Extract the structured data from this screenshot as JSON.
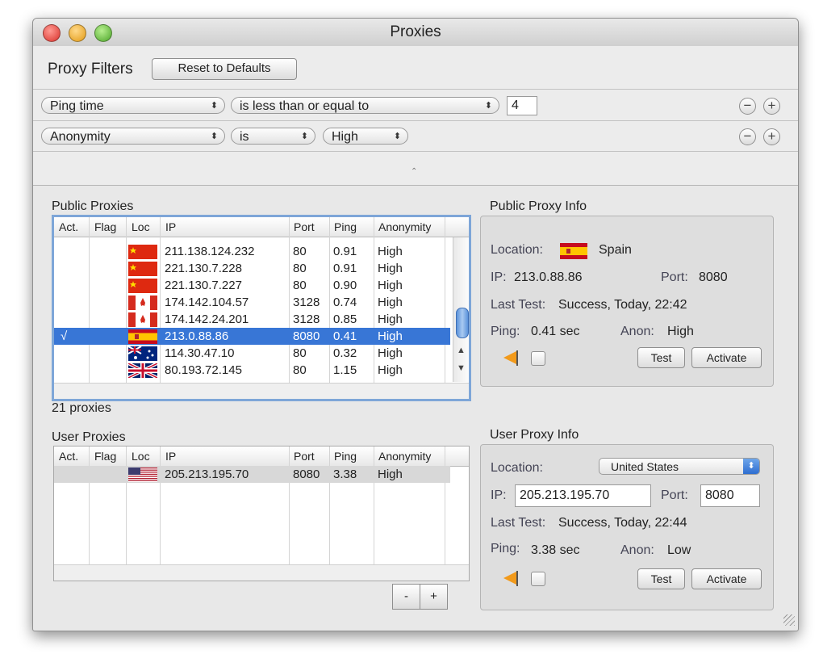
{
  "window": {
    "title": "Proxies"
  },
  "filters": {
    "heading": "Proxy Filters",
    "reset_label": "Reset to Defaults",
    "rows": [
      {
        "field": "Ping time",
        "operator": "is less than or equal to",
        "value": "4"
      },
      {
        "field": "Anonymity",
        "operator": "is",
        "value": "High"
      }
    ],
    "remove_symbol": "−",
    "add_symbol": "+"
  },
  "public_proxies": {
    "heading": "Public Proxies",
    "columns": [
      "Act.",
      "Flag",
      "Loc",
      "IP",
      "Port",
      "Ping",
      "Anonymity"
    ],
    "rows": [
      {
        "active": "",
        "loc": "China",
        "ip": "211.138.124.232",
        "port": "80",
        "ping": "0.91",
        "anon": "High"
      },
      {
        "active": "",
        "loc": "China",
        "ip": "221.130.7.228",
        "port": "80",
        "ping": "0.91",
        "anon": "High"
      },
      {
        "active": "",
        "loc": "China",
        "ip": "221.130.7.227",
        "port": "80",
        "ping": "0.90",
        "anon": "High"
      },
      {
        "active": "",
        "loc": "Canada",
        "ip": "174.142.104.57",
        "port": "3128",
        "ping": "0.74",
        "anon": "High"
      },
      {
        "active": "",
        "loc": "Canada",
        "ip": "174.142.24.201",
        "port": "3128",
        "ping": "0.85",
        "anon": "High"
      },
      {
        "active": "√",
        "loc": "Spain",
        "ip": "213.0.88.86",
        "port": "8080",
        "ping": "0.41",
        "anon": "High"
      },
      {
        "active": "",
        "loc": "Australia",
        "ip": "114.30.47.10",
        "port": "80",
        "ping": "0.32",
        "anon": "High"
      },
      {
        "active": "",
        "loc": "United Kingdom",
        "ip": "80.193.72.145",
        "port": "80",
        "ping": "1.15",
        "anon": "High"
      }
    ],
    "selected_index": 5,
    "count_text": "21 proxies"
  },
  "public_info": {
    "heading": "Public Proxy Info",
    "location_label": "Location:",
    "location_value": "Spain",
    "ip_label": "IP:",
    "ip_value": "213.0.88.86",
    "port_label": "Port:",
    "port_value": "8080",
    "last_test_label": "Last Test:",
    "last_test_value": "Success, Today, 22:42",
    "ping_label": "Ping:",
    "ping_value": "0.41 sec",
    "anon_label": "Anon:",
    "anon_value": "High",
    "test_label": "Test",
    "activate_label": "Activate"
  },
  "user_proxies": {
    "heading": "User Proxies",
    "columns": [
      "Act.",
      "Flag",
      "Loc",
      "IP",
      "Port",
      "Ping",
      "Anonymity"
    ],
    "rows": [
      {
        "active": "",
        "loc": "United States",
        "ip": "205.213.195.70",
        "port": "8080",
        "ping": "3.38",
        "anon": "High"
      }
    ],
    "remove_label": "-",
    "add_label": "+"
  },
  "user_info": {
    "heading": "User Proxy Info",
    "location_label": "Location:",
    "location_value": "United States",
    "ip_label": "IP:",
    "ip_value": "205.213.195.70",
    "port_label": "Port:",
    "port_value": "8080",
    "last_test_label": "Last Test:",
    "last_test_value": "Success, Today, 22:44",
    "ping_label": "Ping:",
    "ping_value": "3.38 sec",
    "anon_label": "Anon:",
    "anon_value": "Low",
    "test_label": "Test",
    "activate_label": "Activate"
  },
  "colors": {
    "selection": "#3876d6",
    "user_row_highlight": "#d8d8d8",
    "focus_ring": "#7ea6d8",
    "close": "#e0443e",
    "minimize": "#e6a21f",
    "zoom": "#5fb636"
  },
  "icons": [
    "close-light",
    "minimize-light",
    "zoom-light",
    "popup-arrows-icon",
    "remove-icon",
    "add-icon",
    "flag-icon",
    "checkmark-icon",
    "scroll-up-icon",
    "scroll-down-icon",
    "resize-grip-icon"
  ]
}
